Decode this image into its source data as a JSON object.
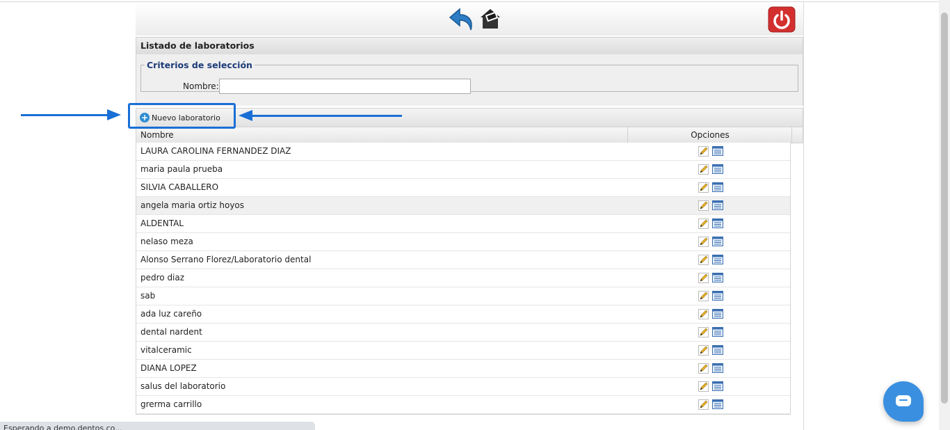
{
  "window": {
    "status_text": "Esperando a demo.dentos.co..."
  },
  "header": {
    "back_icon": "back-arrow-icon",
    "home_icon": "home-icon",
    "power_icon": "power-icon"
  },
  "panel": {
    "title": "Listado de laboratorios"
  },
  "criteria": {
    "legend": "Criterios de selección",
    "nombre_label": "Nombre:",
    "nombre_value": "",
    "nombre_placeholder": ""
  },
  "toolbar": {
    "new_label": "Nuevo laboratorio",
    "new_icon": "plus-circle-icon"
  },
  "grid": {
    "columns": [
      "Nombre",
      "Opciones"
    ],
    "rows": [
      {
        "name": "LAURA CAROLINA FERNANDEZ DIAZ"
      },
      {
        "name": "maria paula prueba"
      },
      {
        "name": "SILVIA CABALLERO"
      },
      {
        "name": "angela maria ortiz hoyos"
      },
      {
        "name": "ALDENTAL"
      },
      {
        "name": "nelaso meza"
      },
      {
        "name": "Alonso Serrano Florez/Laboratorio dental"
      },
      {
        "name": "pedro diaz"
      },
      {
        "name": "sab"
      },
      {
        "name": "ada luz careño"
      },
      {
        "name": "dental nardent"
      },
      {
        "name": "vitalceramic"
      },
      {
        "name": "DIANA LOPEZ"
      },
      {
        "name": "salus del laboratorio"
      },
      {
        "name": "grerma carrillo"
      }
    ],
    "highlighted_row": 3,
    "row_icons": [
      "edit-pencil-icon",
      "details-list-icon"
    ]
  },
  "colors": {
    "accent": "#1a6fd6",
    "legend": "#1c3b78",
    "power": "#d32f2f",
    "chat": "#3a8fe0"
  }
}
